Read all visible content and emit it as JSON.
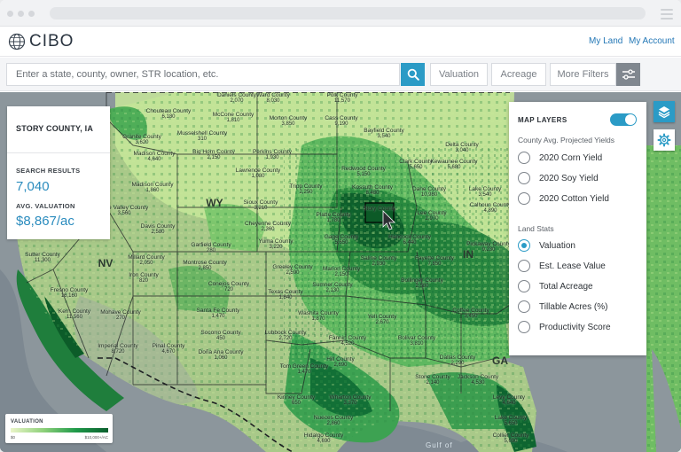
{
  "header": {
    "brand": "CIBO",
    "nav": [
      "My Land",
      "My Account"
    ]
  },
  "search": {
    "placeholder": "Enter a state, county, owner, STR location, etc.",
    "filters": [
      "Valuation",
      "Acreage",
      "More Filters"
    ]
  },
  "info_card": {
    "title": "STORY COUNTY, IA",
    "results_label": "SEARCH RESULTS",
    "results_value": "7,040",
    "valuation_label": "AVG. VALUATION",
    "valuation_value": "$8,867/ac"
  },
  "legend": {
    "title": "VALUATION",
    "min": "$0",
    "max": "$10,000+/AC"
  },
  "layers_panel": {
    "title": "MAP LAYERS",
    "toggle_on": true,
    "groups": [
      {
        "title": "County Avg. Projected Yields",
        "options": [
          {
            "label": "2020 Corn Yield",
            "selected": false
          },
          {
            "label": "2020 Soy Yield",
            "selected": false
          },
          {
            "label": "2020 Cotton Yield",
            "selected": false
          }
        ]
      },
      {
        "title": "Land Stats",
        "options": [
          {
            "label": "Valuation",
            "selected": true
          },
          {
            "label": "Est. Lease Value",
            "selected": false
          },
          {
            "label": "Total Acreage",
            "selected": false
          },
          {
            "label": "Tillable Acres (%)",
            "selected": false
          },
          {
            "label": "Productivity Score",
            "selected": false
          }
        ]
      }
    ]
  },
  "map": {
    "states": [
      "WY",
      "NV",
      "IN",
      "GA"
    ],
    "water_label": "Gulf of",
    "counties": [
      {
        "name": "Daniels County",
        "value": "2,070"
      },
      {
        "name": "Ward County",
        "value": "8,030"
      },
      {
        "name": "Polk County",
        "value": "11,570"
      },
      {
        "name": "Chouteau County",
        "value": "6,180"
      },
      {
        "name": "McCone County",
        "value": "1,810"
      },
      {
        "name": "Morton County",
        "value": "3,850"
      },
      {
        "name": "Cass County",
        "value": "9,190"
      },
      {
        "name": "Granite County",
        "value": "3,620"
      },
      {
        "name": "Musselshell County",
        "value": "310"
      },
      {
        "name": "Perkins County",
        "value": "1,930"
      },
      {
        "name": "Bayfield County",
        "value": "3,540"
      },
      {
        "name": "Madison County",
        "value": "4,640"
      },
      {
        "name": "Big Horn County",
        "value": "2,150"
      },
      {
        "name": "Delta County",
        "value": "3,040"
      },
      {
        "name": "Clark County",
        "value": "5,650"
      },
      {
        "name": "Kewaunee County",
        "value": "5,680"
      },
      {
        "name": "Redwood County",
        "value": "5,150"
      },
      {
        "name": "Lawrence County",
        "value": "1,080"
      },
      {
        "name": "Madison County",
        "value": "1,860"
      },
      {
        "name": "Tripp County",
        "value": "2,250"
      },
      {
        "name": "Kossuth County",
        "value": "8,480"
      },
      {
        "name": "Dane County",
        "value": "10,980"
      },
      {
        "name": "Lake County",
        "value": "3,540"
      },
      {
        "name": "Calhoun County",
        "value": "4,890"
      },
      {
        "name": "Pine Valley County",
        "value": "3,560"
      },
      {
        "name": "Sioux County",
        "value": "3,210"
      },
      {
        "name": "Story County",
        "value": ""
      },
      {
        "name": "Lee County",
        "value": "2,970"
      },
      {
        "name": "Platte County",
        "value": "1,780"
      },
      {
        "name": "Davis County",
        "value": "2,580"
      },
      {
        "name": "Cheyenne County",
        "value": "2,360"
      },
      {
        "name": "Gage County",
        "value": "5,650"
      },
      {
        "name": "Hancock County",
        "value": "6,440"
      },
      {
        "name": "Pickaway County",
        "value": "9,230"
      },
      {
        "name": "Garfield County",
        "value": "280"
      },
      {
        "name": "Yuma County",
        "value": "3,220"
      },
      {
        "name": "Saline County",
        "value": "2,930"
      },
      {
        "name": "Fayette County",
        "value": "7,850"
      },
      {
        "name": "Sutter County",
        "value": "11,300"
      },
      {
        "name": "Millard County",
        "value": "2,050"
      },
      {
        "name": "Montrose County",
        "value": "2,850"
      },
      {
        "name": "Greeley County",
        "value": "2,590"
      },
      {
        "name": "Marion County",
        "value": "2,150"
      },
      {
        "name": "Bollinger County",
        "value": "2,580"
      },
      {
        "name": "Iron County",
        "value": "820"
      },
      {
        "name": "Conejos County",
        "value": "720"
      },
      {
        "name": "Sumner County",
        "value": "2,130"
      },
      {
        "name": "Fresno County",
        "value": "16,160"
      },
      {
        "name": "Texas County",
        "value": "1,840"
      },
      {
        "name": "Kern County",
        "value": "11,560"
      },
      {
        "name": "Mohave County",
        "value": "270"
      },
      {
        "name": "Santa Fe County",
        "value": "1,470"
      },
      {
        "name": "Washita County",
        "value": "1,870"
      },
      {
        "name": "Yell County",
        "value": "2,670"
      },
      {
        "name": "Coffee County",
        "value": "3,450"
      },
      {
        "name": "Imperial County",
        "value": "8,720"
      },
      {
        "name": "Pinal County",
        "value": "4,670"
      },
      {
        "name": "Socorro County",
        "value": "450"
      },
      {
        "name": "Lubbock County",
        "value": "2,720"
      },
      {
        "name": "Fannin County",
        "value": "4,520"
      },
      {
        "name": "Bolivar County",
        "value": "3,810"
      },
      {
        "name": "Doña Ana County",
        "value": "1,060"
      },
      {
        "name": "Hill County",
        "value": "2,690"
      },
      {
        "name": "Dallas County",
        "value": "2,290"
      },
      {
        "name": "Tom Green County",
        "value": "1,470"
      },
      {
        "name": "Stone County",
        "value": "2,140"
      },
      {
        "name": "Jackson County",
        "value": "4,530"
      },
      {
        "name": "Kinney County",
        "value": "650"
      },
      {
        "name": "Wharton County",
        "value": "3,370"
      },
      {
        "name": "Levy County",
        "value": "4,640"
      },
      {
        "name": "Nueces County",
        "value": "2,860"
      },
      {
        "name": "Lake County",
        "value": "5,650"
      },
      {
        "name": "Hidalgo County",
        "value": "4,690"
      },
      {
        "name": "Collier County",
        "value": "5,690"
      }
    ]
  },
  "colors": {
    "accent": "#2b9bc6",
    "valuation_value": "#2b8cbe",
    "link": "#2377b6"
  }
}
